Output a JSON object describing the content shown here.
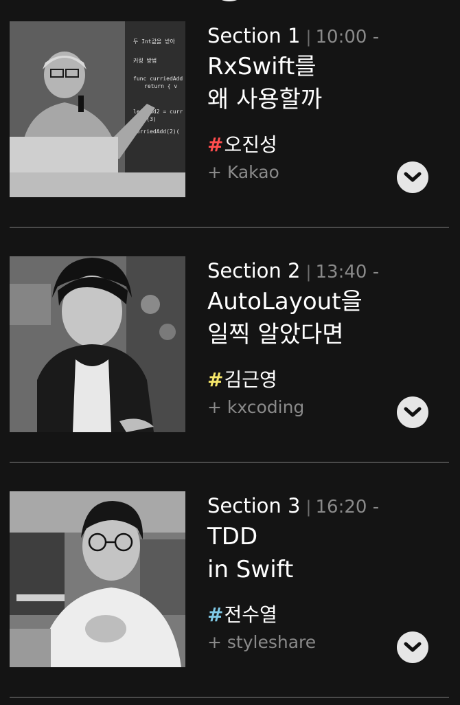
{
  "sessions": [
    {
      "section_label": "Section 1",
      "separator": "|",
      "time": "10:00 -",
      "title_line1": "RxSwift를",
      "title_line2": "왜 사용할까",
      "hash": "#",
      "hash_color": "#ff4d4d",
      "speaker": "오진성",
      "company": "+ Kakao",
      "photo_icon": "speaker-photo",
      "toggle_icon": "chevron-down-icon",
      "photo_text": [
        "두 Int값을 받아",
        "커링 방법",
        "func curriedAdd",
        "return { v",
        "let add2 = curr",
        "add2(3)",
        "curriedAdd(2)("
      ]
    },
    {
      "section_label": "Section 2",
      "separator": "|",
      "time": "13:40 -",
      "title_line1": "AutoLayout을",
      "title_line2": "일찍 알았다면",
      "hash": "#",
      "hash_color": "#f5e66a",
      "speaker": "김근영",
      "company": "+ kxcoding",
      "photo_icon": "speaker-photo",
      "toggle_icon": "chevron-down-icon"
    },
    {
      "section_label": "Section 3",
      "separator": "|",
      "time": "16:20 -",
      "title_line1": "TDD",
      "title_line2": "in Swift",
      "hash": "#",
      "hash_color": "#7fc9e6",
      "speaker": "전수열",
      "company": "+ styleshare",
      "photo_icon": "speaker-photo",
      "toggle_icon": "chevron-down-icon"
    }
  ]
}
